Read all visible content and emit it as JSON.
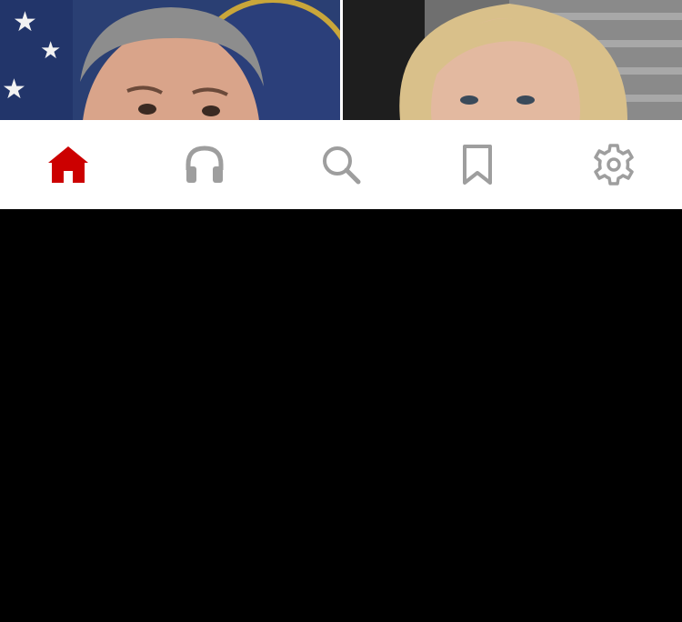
{
  "colors": {
    "active": "#cc0000",
    "inactive": "#9e9e9e",
    "tab_bar_bg": "#ffffff",
    "page_bg": "#000000"
  },
  "photo_strip": {
    "images": [
      {
        "name": "left-photo"
      },
      {
        "name": "right-photo"
      }
    ]
  },
  "tab_bar": {
    "tabs": [
      {
        "icon": "home-icon",
        "active": true
      },
      {
        "icon": "headphones-icon",
        "active": false
      },
      {
        "icon": "search-icon",
        "active": false
      },
      {
        "icon": "bookmark-icon",
        "active": false
      },
      {
        "icon": "gear-icon",
        "active": false
      }
    ]
  }
}
